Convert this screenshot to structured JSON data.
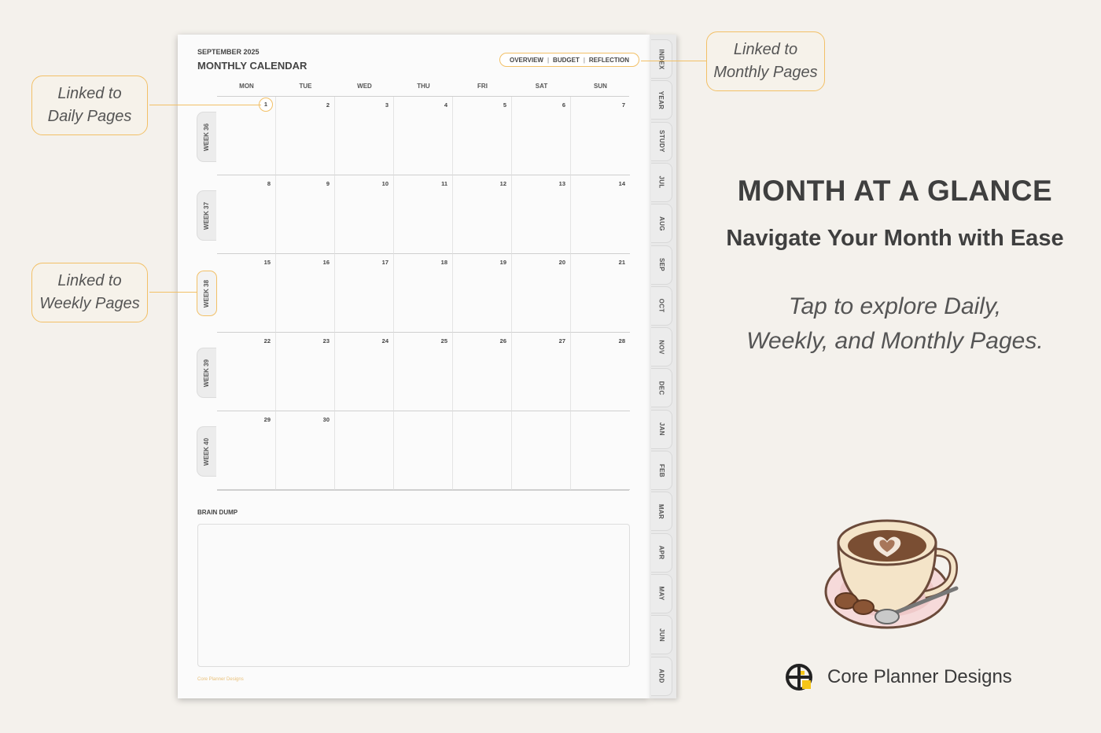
{
  "page": {
    "month_label": "SEPTEMBER 2025",
    "title": "MONTHLY CALENDAR",
    "top_links": [
      "OVERVIEW",
      "BUDGET",
      "REFLECTION"
    ],
    "day_names": [
      "MON",
      "TUE",
      "WED",
      "THU",
      "FRI",
      "SAT",
      "SUN"
    ],
    "weeks": [
      {
        "label": "WEEK 36",
        "days": [
          "1",
          "2",
          "3",
          "4",
          "5",
          "6",
          "7"
        ]
      },
      {
        "label": "WEEK 37",
        "days": [
          "8",
          "9",
          "10",
          "11",
          "12",
          "13",
          "14"
        ]
      },
      {
        "label": "WEEK 38",
        "days": [
          "15",
          "16",
          "17",
          "18",
          "19",
          "20",
          "21"
        ]
      },
      {
        "label": "WEEK 39",
        "days": [
          "22",
          "23",
          "24",
          "25",
          "26",
          "27",
          "28"
        ]
      },
      {
        "label": "WEEK 40",
        "days": [
          "29",
          "30",
          "",
          "",
          "",
          "",
          ""
        ]
      }
    ],
    "brain_dump_label": "BRAIN DUMP",
    "footer_brand": "Core Planner Designs"
  },
  "side_tabs": [
    "INDEX",
    "YEAR",
    "STUDY",
    "JUL",
    "AUG",
    "SEP",
    "OCT",
    "NOV",
    "DEC",
    "JAN",
    "FEB",
    "MAR",
    "APR",
    "MAY",
    "JUN",
    "ADD"
  ],
  "callouts": {
    "daily": {
      "line1": "Linked to",
      "line2": "Daily Pages"
    },
    "weekly": {
      "line1": "Linked to",
      "line2": "Weekly Pages"
    },
    "monthly": {
      "line1": "Linked to",
      "line2": "Monthly Pages"
    }
  },
  "promo": {
    "headline": "MONTH AT A GLANCE",
    "subheadline": "Navigate Your Month with Ease",
    "tagline_line1": "Tap to explore Daily,",
    "tagline_line2": "Weekly, and Monthly Pages."
  },
  "brand": {
    "name": "Core Planner Designs",
    "logo_icon": "crosshair-logo-icon"
  },
  "colors": {
    "accent": "#f2c067",
    "background": "#f4f1ec",
    "page": "#fbfbfb"
  }
}
